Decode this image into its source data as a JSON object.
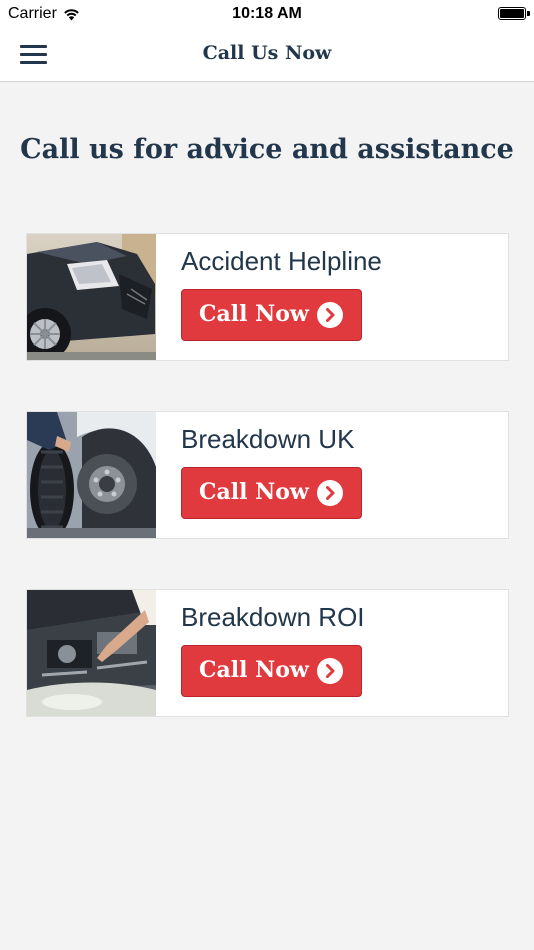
{
  "status_bar": {
    "carrier": "Carrier",
    "time": "10:18 AM",
    "wifi_icon": "wifi-icon",
    "battery_icon": "battery-icon",
    "battery_level": 1.0
  },
  "nav": {
    "title": "Call Us Now",
    "menu_icon": "hamburger-menu-icon"
  },
  "heading": "Call us for advice and assistance",
  "cards": [
    {
      "title": "Accident Helpline",
      "button_label": "Call Now",
      "image": "damaged-car-photo",
      "icon": "chevron-right-circle-icon"
    },
    {
      "title": "Breakdown UK",
      "button_label": "Call Now",
      "image": "tyre-change-photo",
      "icon": "chevron-right-circle-icon"
    },
    {
      "title": "Breakdown ROI",
      "button_label": "Call Now",
      "image": "engine-repair-photo",
      "icon": "chevron-right-circle-icon"
    }
  ],
  "colors": {
    "primary_text": "#22374b",
    "accent_red": "#e0393e",
    "background": "#f3f3f3",
    "card": "#ffffff"
  }
}
